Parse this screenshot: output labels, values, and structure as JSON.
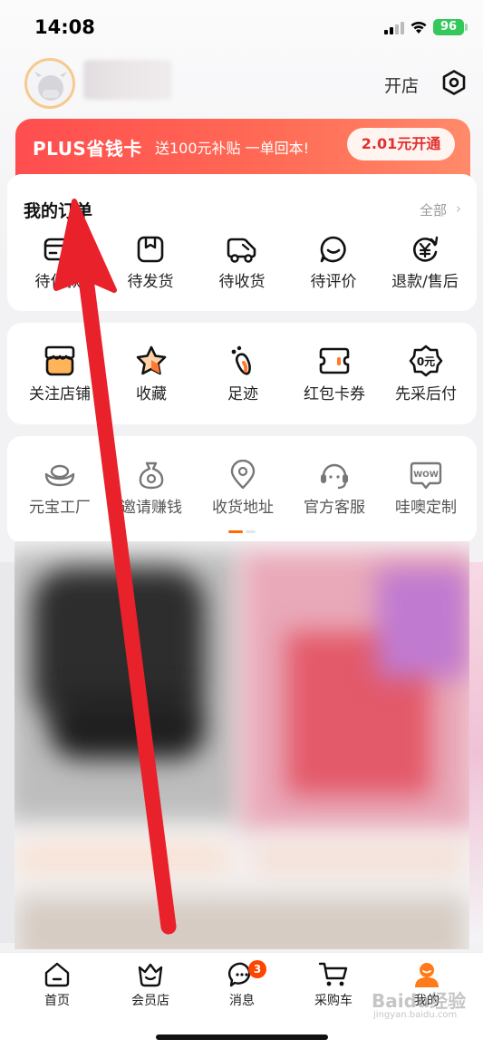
{
  "status_bar": {
    "time": "14:08",
    "battery": "96"
  },
  "header": {
    "open_store": "开店"
  },
  "plus_banner": {
    "title": "PLUS省钱卡",
    "subtitle": "送100元补贴 一单回本!",
    "button": "2.01元开通"
  },
  "orders": {
    "title": "我的订单",
    "all_link": "全部",
    "items": [
      {
        "label": "待付款",
        "icon": "wallet-icon"
      },
      {
        "label": "待发货",
        "icon": "package-icon"
      },
      {
        "label": "待收货",
        "icon": "truck-icon"
      },
      {
        "label": "待评价",
        "icon": "comment-icon"
      },
      {
        "label": "退款/售后",
        "icon": "refund-icon"
      }
    ]
  },
  "favorites": {
    "items": [
      {
        "label": "关注店铺",
        "icon": "shop-icon"
      },
      {
        "label": "收藏",
        "icon": "star-icon"
      },
      {
        "label": "足迹",
        "icon": "footprint-icon"
      },
      {
        "label": "红包卡券",
        "icon": "coupon-icon"
      },
      {
        "label": "先采后付",
        "icon": "pay-later-icon",
        "icon_text": "0元"
      }
    ]
  },
  "tools": {
    "items": [
      {
        "label": "元宝工厂",
        "icon": "ingot-icon"
      },
      {
        "label": "邀请赚钱",
        "icon": "money-bag-icon"
      },
      {
        "label": "收货地址",
        "icon": "location-icon"
      },
      {
        "label": "官方客服",
        "icon": "headset-icon"
      },
      {
        "label": "哇噢定制",
        "icon": "wow-icon",
        "icon_text": "WOW"
      }
    ]
  },
  "tab_bar": {
    "tabs": [
      {
        "label": "首页",
        "icon": "home-icon"
      },
      {
        "label": "会员店",
        "icon": "member-store-icon"
      },
      {
        "label": "消息",
        "icon": "message-icon",
        "badge": "3"
      },
      {
        "label": "采购车",
        "icon": "cart-icon"
      },
      {
        "label": "我的",
        "icon": "profile-icon"
      }
    ]
  },
  "watermark": {
    "text": "Baidu经验",
    "url": "jingyan.baidu.com"
  },
  "colors": {
    "accent": "#ff6a00",
    "plus_red": "#ff4d4f",
    "badge": "#ff4400"
  }
}
